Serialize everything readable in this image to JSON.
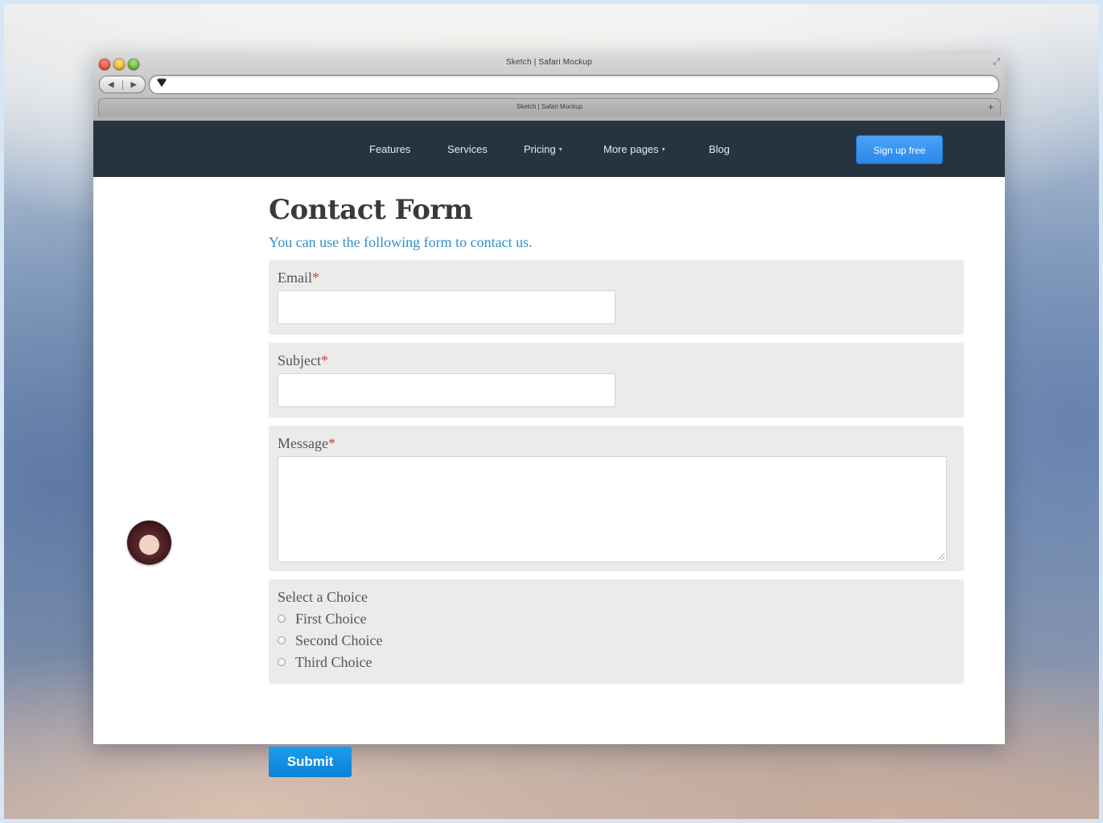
{
  "browser": {
    "window_title": "Sketch | Safari Mockup",
    "tab_title": "Sketch | Safari Mockup",
    "back_icon": "◀",
    "forward_icon": "▶",
    "resize_icon": "⤢",
    "add_tab_icon": "+",
    "url_icon": "⯆"
  },
  "nav": {
    "items": [
      {
        "label": "Features"
      },
      {
        "label": "Services"
      },
      {
        "label": "Pricing",
        "caret": "▾"
      },
      {
        "label": "More pages",
        "caret": "▾"
      },
      {
        "label": "Blog"
      }
    ],
    "signup_label": "Sign up free",
    "colors": {
      "bar": "#263440",
      "signup": "#3396f2"
    }
  },
  "form": {
    "title": "Contact Form",
    "subtitle": "You can use the following form to contact us.",
    "required_mark": "*",
    "email_label": "Email",
    "subject_label": "Subject",
    "message_label": "Message",
    "choice_label": "Select a Choice",
    "choices": [
      "First Choice",
      "Second Choice",
      "Third Choice"
    ],
    "submit_label": "Submit",
    "colors": {
      "accent": "#2f8fcf",
      "required": "#e0403a",
      "submit": "#118edf"
    }
  }
}
